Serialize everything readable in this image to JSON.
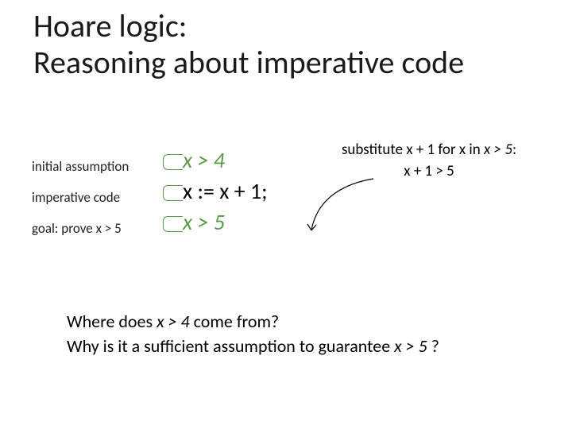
{
  "title_line1": "Hoare logic:",
  "title_line2": "Reasoning about imperative code",
  "labels": {
    "l1": "initial assumption",
    "l2": "imperative code",
    "l3": "goal: prove x > 5"
  },
  "code": {
    "pre": "x > 4",
    "stmt": "x := x + 1;",
    "post": "x > 5"
  },
  "subst": {
    "line1_a": "substitute x + 1 for x in ",
    "line1_b": "x > 5",
    "line1_c": ":",
    "line2": "x + 1 > 5"
  },
  "questions": {
    "q1_a": "Where does ",
    "q1_b": "x > 4",
    "q1_c": " come from?",
    "q2_a": "Why is it a sufficient assumption to guarantee ",
    "q2_b": "x > 5",
    "q2_c": " ?"
  }
}
